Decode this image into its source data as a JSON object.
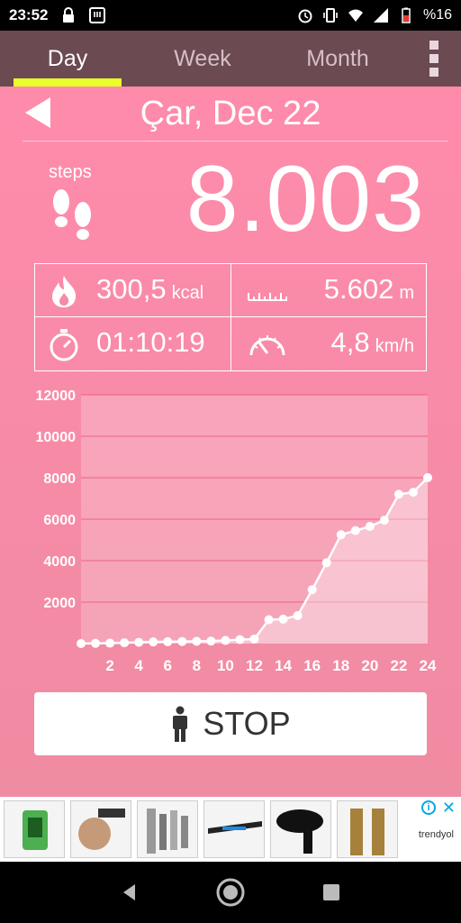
{
  "status_bar": {
    "time": "23:52",
    "battery": "%16"
  },
  "tabs": [
    {
      "label": "Day",
      "active": true
    },
    {
      "label": "Week",
      "active": false
    },
    {
      "label": "Month",
      "active": false
    }
  ],
  "date": "Çar, Dec 22",
  "steps": {
    "label": "steps",
    "value": "8.003"
  },
  "stats": {
    "calories": {
      "value": "300,5",
      "unit": "kcal"
    },
    "distance": {
      "value": "5.602",
      "unit": "m"
    },
    "duration": {
      "value": "01:10:19"
    },
    "speed": {
      "value": "4,8",
      "unit": "km/h"
    }
  },
  "chart_data": {
    "type": "area",
    "x": [
      0,
      1,
      2,
      3,
      4,
      5,
      6,
      7,
      8,
      9,
      10,
      11,
      12,
      13,
      14,
      15,
      16,
      17,
      18,
      19,
      20,
      21,
      22,
      23,
      24
    ],
    "values": [
      0,
      10,
      20,
      40,
      60,
      80,
      90,
      100,
      110,
      120,
      150,
      190,
      220,
      1150,
      1180,
      1350,
      2600,
      3900,
      5250,
      5450,
      5650,
      5950,
      7200,
      7300,
      8003
    ],
    "xticks": [
      "2",
      "4",
      "6",
      "8",
      "10",
      "12",
      "14",
      "16",
      "18",
      "20",
      "22",
      "24"
    ],
    "yticks": [
      "2000",
      "4000",
      "6000",
      "8000",
      "10000",
      "12000"
    ],
    "ylim": [
      0,
      12000
    ],
    "xlim": [
      0,
      24
    ],
    "grid": true
  },
  "stop_label": "STOP",
  "ad": {
    "brand": "trendyol"
  }
}
